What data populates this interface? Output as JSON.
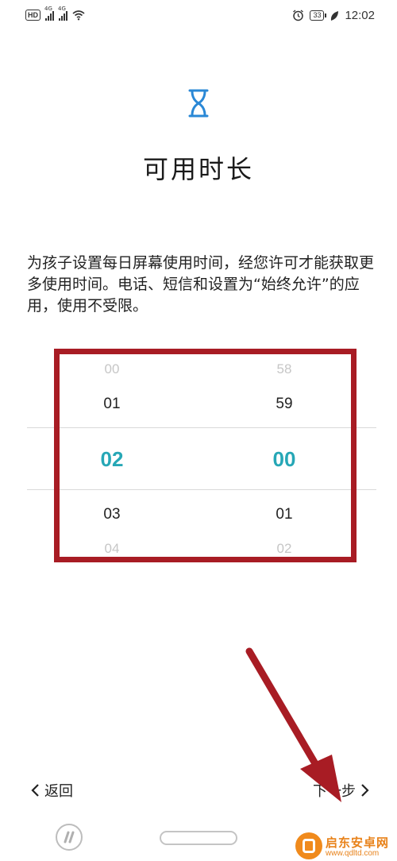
{
  "status_bar": {
    "network_left": "HD",
    "sim1": "4G",
    "sim2": "4G",
    "battery": "33",
    "time": "12:02"
  },
  "page": {
    "title": "可用时长",
    "description": "为孩子设置每日屏幕使用时间，经您许可才能获取更多使用时间。电话、短信和设置为“始终允许”的应用，使用不受限。"
  },
  "picker": {
    "hours": {
      "above2": "00",
      "above1": "01",
      "selected": "02",
      "below1": "03",
      "below2": "04"
    },
    "minutes": {
      "above2": "58",
      "above1": "59",
      "selected": "00",
      "below1": "01",
      "below2": "02"
    }
  },
  "nav": {
    "back_label": "返回",
    "next_label": "下一步"
  },
  "watermark": {
    "name": "启东安卓网",
    "url": "www.qdltd.com"
  },
  "colors": {
    "accent": "#26a7b6",
    "annotation_red": "#a81c24",
    "watermark_orange": "#e8821a"
  }
}
